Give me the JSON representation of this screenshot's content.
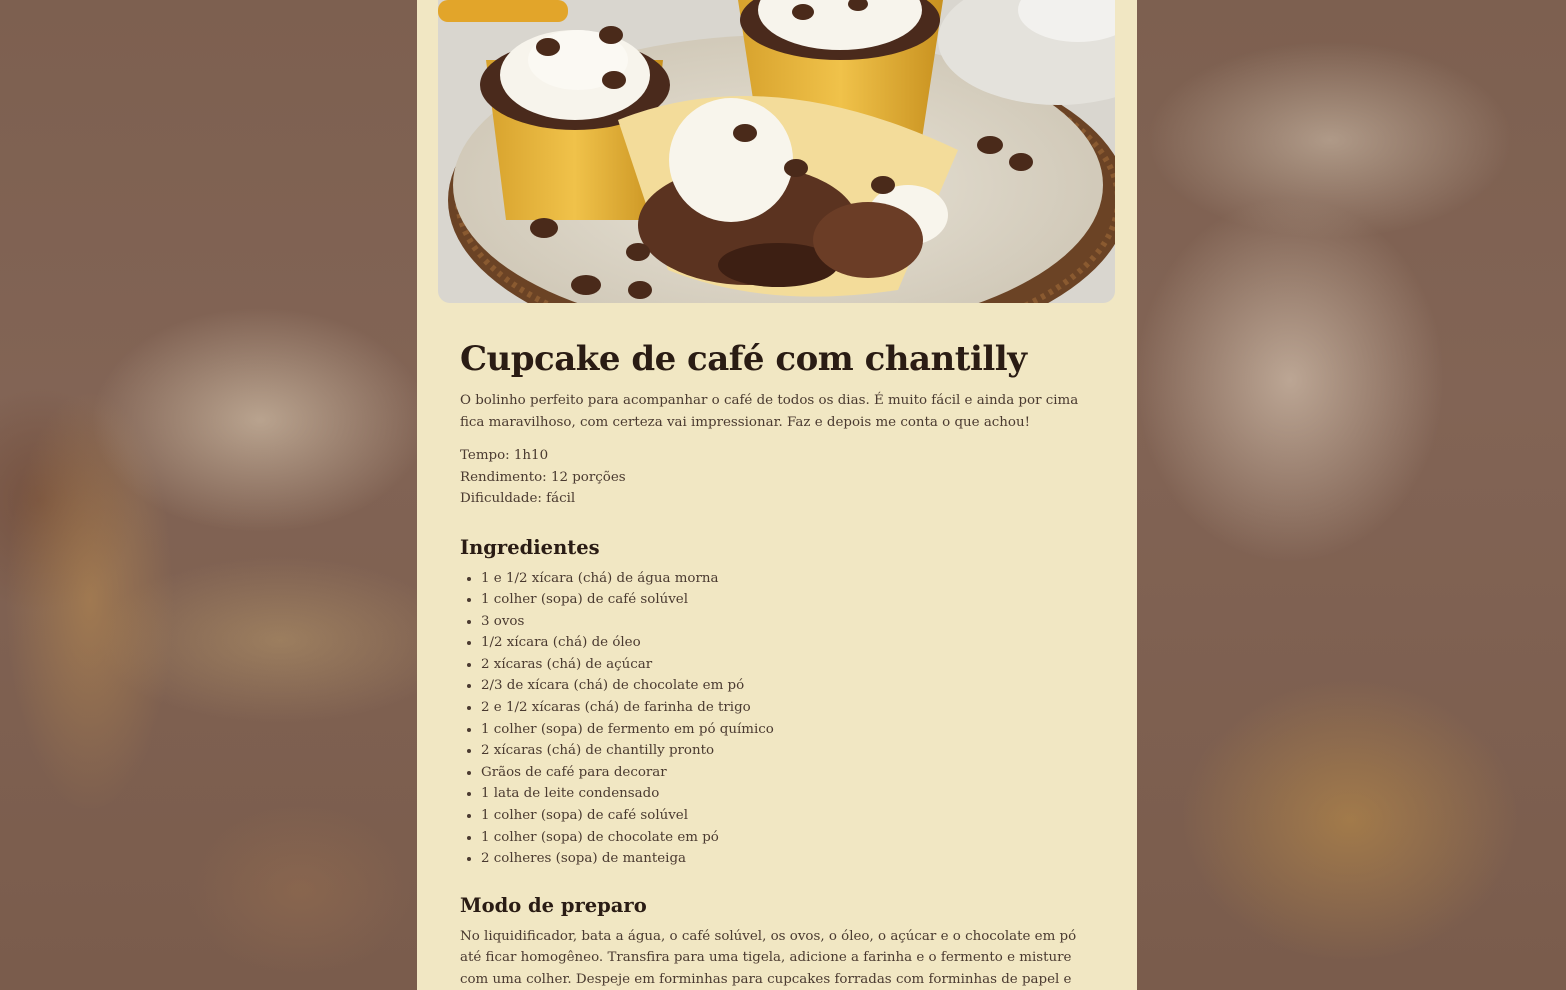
{
  "recipe": {
    "title": "Cupcake de café com chantilly",
    "intro": "O bolinho perfeito para acompanhar o café de todos os dias. É muito fácil e ainda por cima fica maravilhoso, com certeza vai impressionar. Faz e depois me conta o que achou!",
    "meta": {
      "time": "Tempo: 1h10",
      "yield": "Rendimento: 12 porções",
      "difficulty": "Dificuldade: fácil"
    },
    "ingredients_title": "Ingredientes",
    "ingredients": [
      "1 e 1/2 xícara (chá) de água morna",
      "1 colher (sopa) de café solúvel",
      "3 ovos",
      "1/2 xícara (chá) de óleo",
      "2 xícaras (chá) de açúcar",
      "2/3 de xícara (chá) de chocolate em pó",
      "2 e 1/2 xícaras (chá) de farinha de trigo",
      "1 colher (sopa) de fermento em pó químico",
      "2 xícaras (chá) de chantilly pronto",
      "Grãos de café para decorar",
      "1 lata de leite condensado",
      "1 colher (sopa) de café solúvel",
      "1 colher (sopa) de chocolate em pó",
      "2 colheres (sopa) de manteiga"
    ],
    "preparation_title": "Modo de preparo",
    "preparation": "No liquidificador, bata a água, o café solúvel, os ovos, o óleo, o açúcar e o chocolate em pó até ficar homogêneo. Transfira para uma tigela, adicione a farinha e o fermento e misture com uma colher. Despeje em forminhas para cupcakes forradas com forminhas de papel e coloque em uma fôrma"
  },
  "colors": {
    "card_background": "#f1e7c3",
    "heading": "#2a1c14",
    "body_text": "#4a3a30",
    "page_background": "#7a5c4c"
  }
}
